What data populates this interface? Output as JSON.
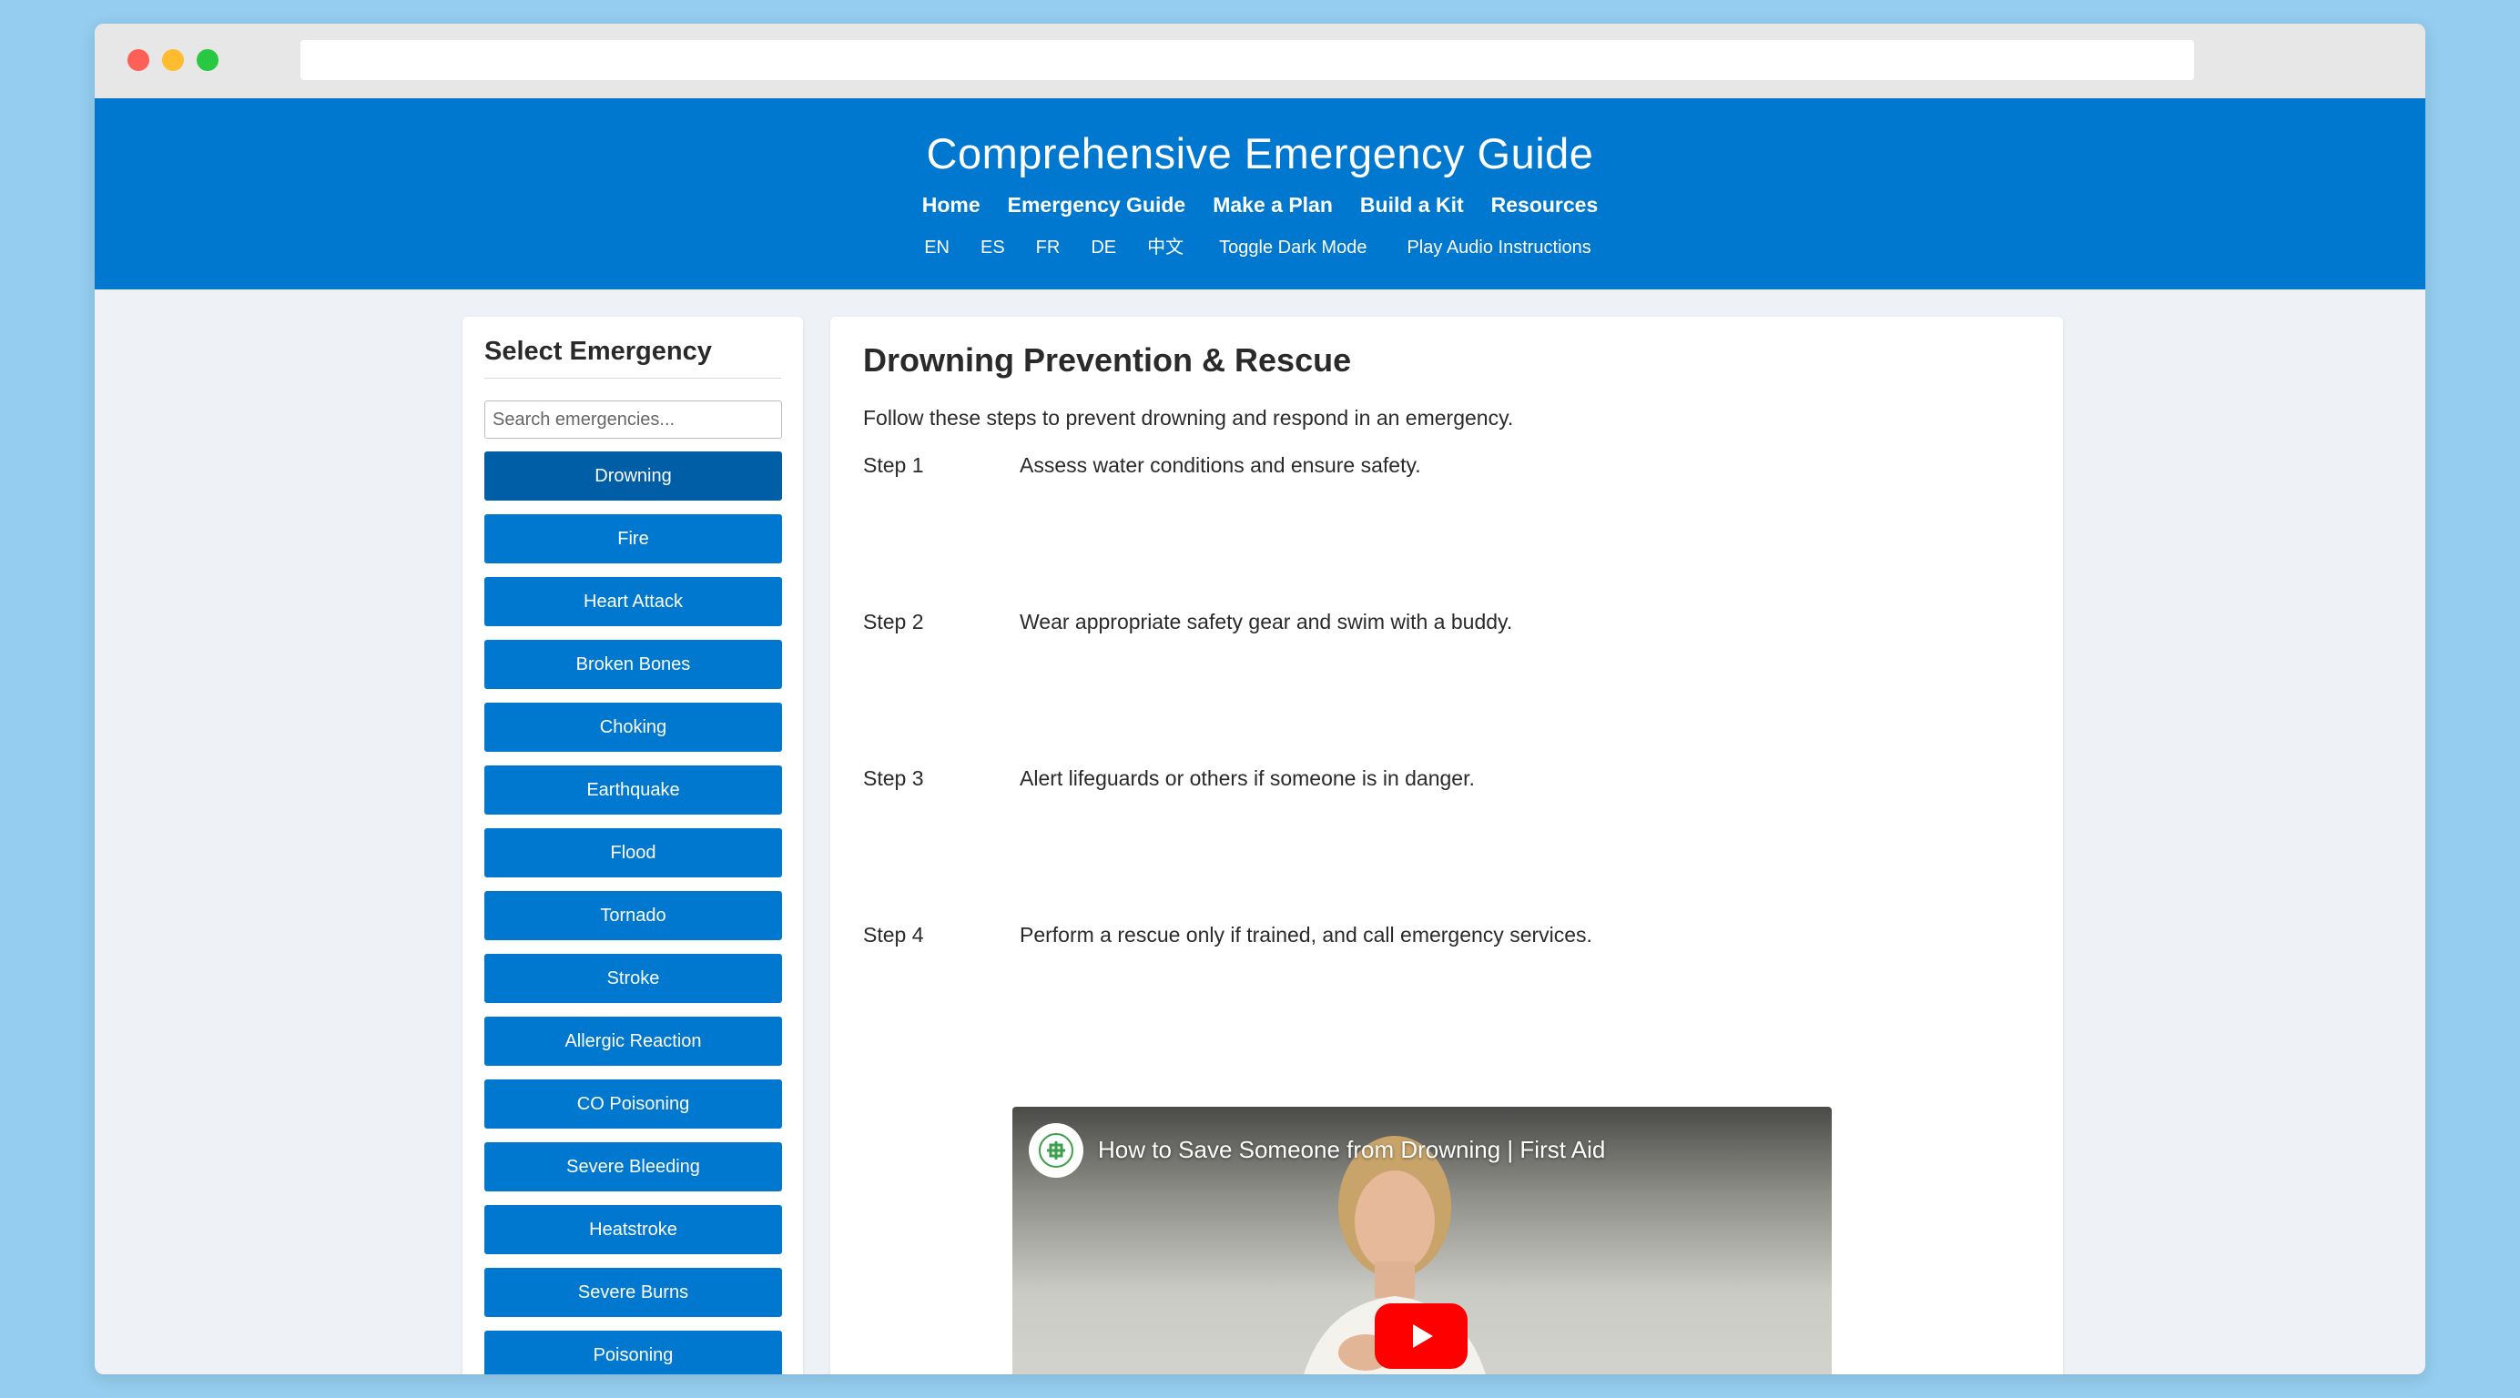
{
  "header": {
    "title": "Comprehensive Emergency Guide",
    "nav": [
      "Home",
      "Emergency Guide",
      "Make a Plan",
      "Build a Kit",
      "Resources"
    ],
    "languages": [
      "EN",
      "ES",
      "FR",
      "DE",
      "中文"
    ],
    "dark_mode": "Toggle Dark Mode",
    "audio": "Play Audio Instructions"
  },
  "sidebar": {
    "title": "Select Emergency",
    "search_placeholder": "Search emergencies...",
    "items": [
      "Drowning",
      "Fire",
      "Heart Attack",
      "Broken Bones",
      "Choking",
      "Earthquake",
      "Flood",
      "Tornado",
      "Stroke",
      "Allergic Reaction",
      "CO Poisoning",
      "Severe Bleeding",
      "Heatstroke",
      "Severe Burns",
      "Poisoning"
    ],
    "active": "Drowning"
  },
  "content": {
    "title": "Drowning Prevention & Rescue",
    "intro": "Follow these steps to prevent drowning and respond in an emergency.",
    "steps": [
      {
        "label": "Step 1",
        "text": "Assess water conditions and ensure safety."
      },
      {
        "label": "Step 2",
        "text": "Wear appropriate safety gear and swim with a buddy."
      },
      {
        "label": "Step 3",
        "text": "Alert lifeguards or others if someone is in danger."
      },
      {
        "label": "Step 4",
        "text": "Perform a rescue only if trained, and call emergency services."
      }
    ],
    "video_title": "How to Save Someone from Drowning | First Aid"
  },
  "colors": {
    "header_bg": "#0078d0",
    "button_bg": "#0078d0",
    "button_active": "#005ea6",
    "page_bg": "#94cdef"
  }
}
